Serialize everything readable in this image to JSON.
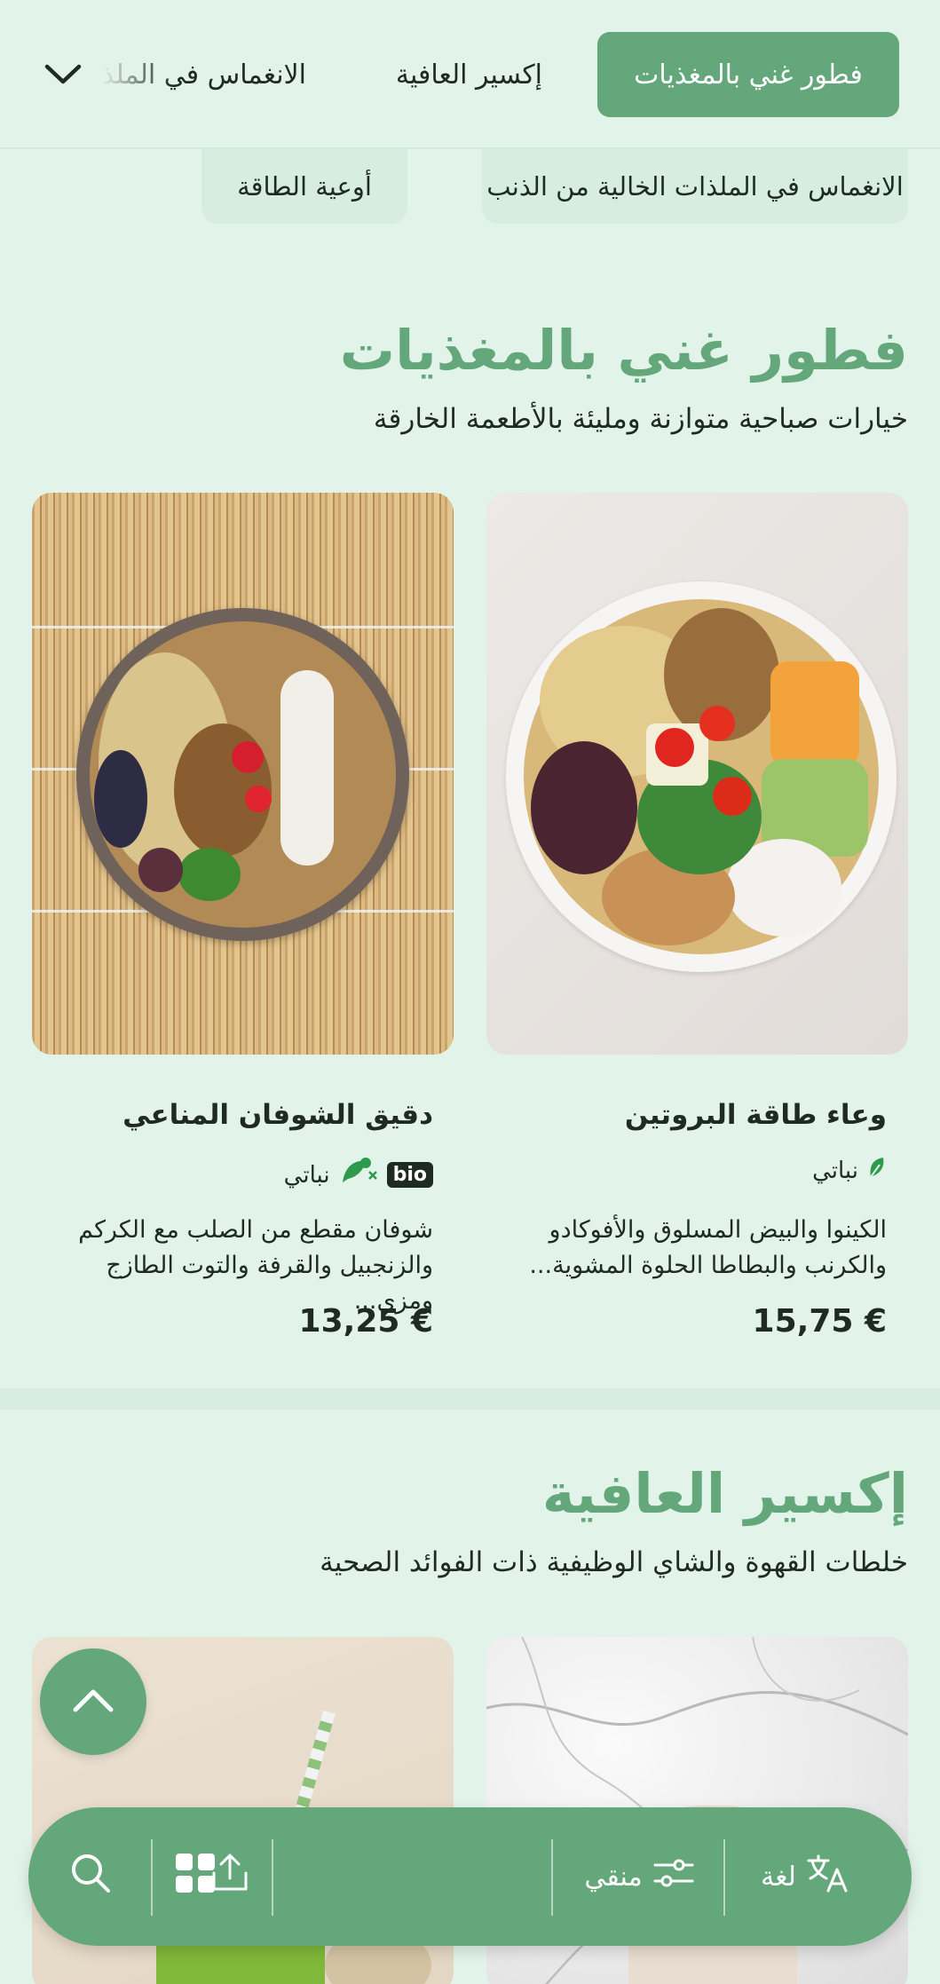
{
  "tabs": {
    "active": "فطور غني بالمغذيات",
    "second": "إكسير العافية",
    "third": "الانغماس في الملذات"
  },
  "chips": [
    "الانغماس في الملذات الخالية من الذنب",
    "أوعية الطاقة"
  ],
  "sections": [
    {
      "title": "فطور غني بالمغذيات",
      "subtitle": "خيارات صباحية متوازنة ومليئة بالأطعمة الخارقة",
      "items": [
        {
          "name": "وعاء طاقة البروتين",
          "diet": "نباتي",
          "description": "الكينوا والبيض المسلوق والأفوكادو والكرنب والبطاطا الحلوة المشوية...",
          "price": "15,75 €",
          "icon": "leaf-icon"
        },
        {
          "name": "دقيق الشوفان المناعي",
          "diet": "نباتي",
          "badge": "bio",
          "description": "شوفان مقطع من الصلب مع الكركم والزنجبيل والقرفة والتوت الطازج ومزي...",
          "price": "13,25 €",
          "icon": "no-meat-icon"
        }
      ]
    },
    {
      "title": "إكسير العافية",
      "subtitle": "خلطات القهوة والشاي الوظيفية ذات الفوائد الصحية"
    }
  ],
  "bottom_bar": {
    "language_label": "لغة",
    "filter_label": "منقي"
  },
  "colors": {
    "accent": "#63a77b",
    "background": "#e2f4ea",
    "text": "#1f2a24"
  }
}
